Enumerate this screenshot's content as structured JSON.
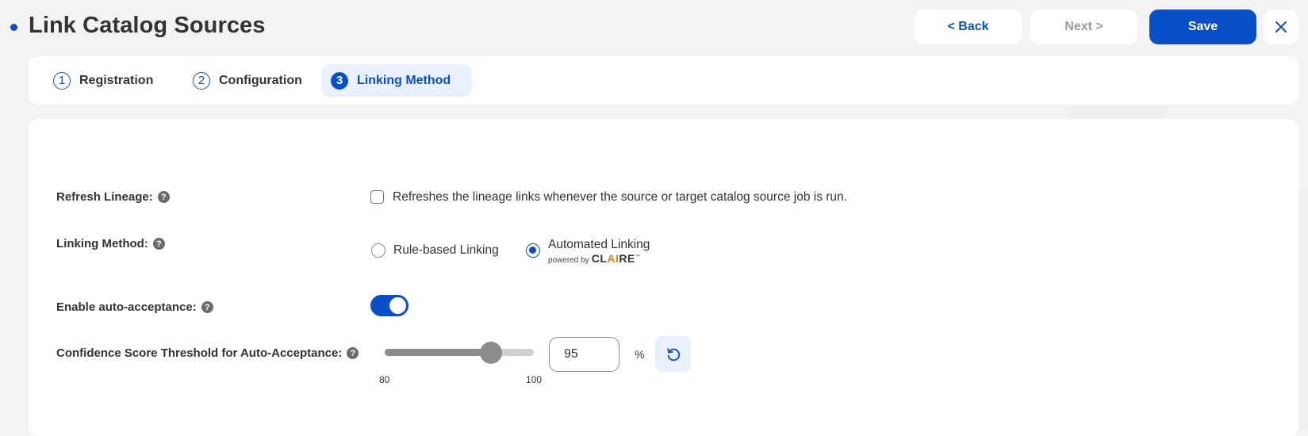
{
  "header": {
    "title": "Link Catalog Sources",
    "back_label": "< Back",
    "next_label": "Next >",
    "save_label": "Save",
    "close_icon": "close-icon"
  },
  "steps": [
    {
      "number": "1",
      "label": "Registration",
      "active": false
    },
    {
      "number": "2",
      "label": "Configuration",
      "active": false
    },
    {
      "number": "3",
      "label": "Linking Method",
      "active": true
    }
  ],
  "form": {
    "refresh_lineage": {
      "label": "Refresh Lineage:",
      "help_icon": "?",
      "checkbox_text": "Refreshes the lineage links whenever the source or target catalog source job is run.",
      "checked": false
    },
    "linking_method": {
      "label": "Linking Method:",
      "help_icon": "?",
      "options": [
        {
          "label": "Rule-based Linking",
          "selected": false
        },
        {
          "label": "Automated Linking",
          "selected": true
        }
      ],
      "powered_by": "powered by",
      "brand_pre": "CL",
      "brand_ai": "AI",
      "brand_post": "RE",
      "trademark": "™"
    },
    "auto_acceptance": {
      "label": "Enable auto-acceptance:",
      "help_icon": "?",
      "enabled": true
    },
    "confidence_threshold": {
      "label": "Confidence Score Threshold for Auto-Acceptance:",
      "help_icon": "?",
      "min": 80,
      "max": 100,
      "min_label": "80",
      "max_label": "100",
      "value": 95,
      "value_text": "95",
      "unit": "%",
      "reset_icon": "reset-icon"
    }
  },
  "colors": {
    "accent": "#0b4fc8",
    "active_step_bg": "#e9f0fc",
    "background": "#f3f3f3",
    "brand_ai": "#e5801a",
    "slider_fill": "#8c8c8c",
    "slider_track": "#d0d0d0"
  }
}
